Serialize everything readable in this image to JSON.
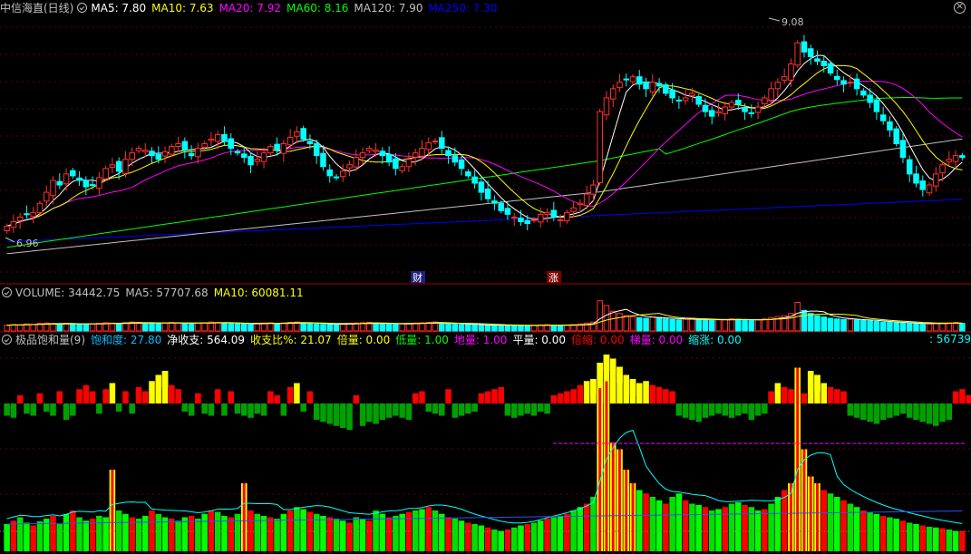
{
  "header_price": {
    "title": "中信海直(日线)",
    "items": [
      {
        "label": "MA5: 7.80",
        "color": "#ffffff"
      },
      {
        "label": "MA10: 7.63",
        "color": "#ffff00"
      },
      {
        "label": "MA20: 7.92",
        "color": "#ff00ff"
      },
      {
        "label": "MA60: 8.16",
        "color": "#00ff00"
      },
      {
        "label": "MA120: 7.90",
        "color": "#c0c0c0"
      },
      {
        "label": "MA250: 7.30",
        "color": "#0000ff"
      }
    ]
  },
  "header_volume": {
    "items": [
      {
        "label": "VOLUME: 34442.75",
        "color": "#c0c0c0"
      },
      {
        "label": "MA5: 57707.68",
        "color": "#c0c0c0"
      },
      {
        "label": "MA10: 60081.11",
        "color": "#ffff00"
      }
    ]
  },
  "header_indicator": {
    "title": "极品饱和量(9)",
    "items": [
      {
        "label": "饱和度: 27.80",
        "color": "#00c0ff"
      },
      {
        "label": "净收支: 564.09",
        "color": "#ffffff"
      },
      {
        "label": "收支比%: 21.07",
        "color": "#ffff00"
      },
      {
        "label": "倍量: 0.00",
        "color": "#ffff00"
      },
      {
        "label": "低量: 1.00",
        "color": "#00ff00"
      },
      {
        "label": "地量: 1.00",
        "color": "#ff00ff"
      },
      {
        "label": "平量: 0.00",
        "color": "#ffffff"
      },
      {
        "label": "倍缩: 0.00",
        "color": "#ff0000"
      },
      {
        "label": "梯量: 0.00",
        "color": "#ff00ff"
      },
      {
        "label": "缩涨: 0.00",
        "color": "#00ffff"
      }
    ],
    "right_value": ": 56739"
  },
  "chart_data": [
    {
      "type": "candlestick",
      "annotations": {
        "max_label": "9.08",
        "min_label": "6.96",
        "event_labels": [
          "财",
          "涨"
        ]
      },
      "ylim": [
        6.6,
        9.3
      ],
      "series_colors": {
        "up": "#ff3030",
        "down": "#00ffff",
        "ma5": "#ffffff",
        "ma10": "#ffff00",
        "ma20": "#ff00ff",
        "ma60": "#00ff00",
        "ma120": "#c0c0c0",
        "ma250": "#0000ff"
      },
      "closes": [
        7.05,
        7.1,
        7.15,
        7.18,
        7.2,
        7.3,
        7.42,
        7.55,
        7.5,
        7.62,
        7.6,
        7.55,
        7.48,
        7.5,
        7.58,
        7.68,
        7.72,
        7.65,
        7.78,
        7.85,
        7.9,
        7.88,
        7.82,
        7.78,
        7.86,
        7.92,
        7.95,
        7.88,
        7.82,
        7.9,
        7.95,
        8.0,
        8.05,
        7.98,
        7.9,
        7.85,
        7.8,
        7.72,
        7.78,
        7.85,
        7.92,
        7.88,
        7.95,
        8.02,
        8.08,
        8.0,
        7.95,
        7.82,
        7.7,
        7.6,
        7.58,
        7.65,
        7.72,
        7.8,
        7.85,
        7.9,
        7.88,
        7.82,
        7.75,
        7.68,
        7.7,
        7.78,
        7.85,
        7.9,
        7.96,
        7.98,
        7.9,
        7.82,
        7.75,
        7.68,
        7.6,
        7.52,
        7.42,
        7.35,
        7.3,
        7.22,
        7.18,
        7.15,
        7.1,
        7.08,
        7.12,
        7.18,
        7.2,
        7.15,
        7.12,
        7.2,
        7.25,
        7.3,
        7.4,
        7.5,
        8.3,
        8.45,
        8.55,
        8.62,
        8.65,
        8.68,
        8.6,
        8.55,
        8.62,
        8.58,
        8.5,
        8.45,
        8.42,
        8.45,
        8.5,
        8.38,
        8.3,
        8.25,
        8.3,
        8.35,
        8.4,
        8.38,
        8.3,
        8.28,
        8.35,
        8.45,
        8.55,
        8.62,
        8.68,
        8.82,
        9.05,
        8.95,
        8.9,
        8.85,
        8.8,
        8.72,
        8.65,
        8.6,
        8.62,
        8.55,
        8.48,
        8.4,
        8.3,
        8.2,
        8.1,
        7.95,
        7.8,
        7.62,
        7.52,
        7.45,
        7.5,
        7.62,
        7.72,
        7.78,
        7.82,
        7.8
      ],
      "volumes": [
        18,
        20,
        19,
        22,
        21,
        24,
        25,
        23,
        22,
        24,
        23,
        21,
        20,
        22,
        24,
        26,
        25,
        24,
        26,
        28,
        27,
        25,
        24,
        23,
        25,
        27,
        26,
        24,
        23,
        25,
        26,
        28,
        27,
        25,
        24,
        23,
        22,
        21,
        23,
        25,
        26,
        24,
        25,
        27,
        28,
        26,
        24,
        22,
        21,
        20,
        21,
        22,
        24,
        25,
        26,
        27,
        25,
        23,
        22,
        21,
        22,
        24,
        25,
        26,
        27,
        28,
        25,
        23,
        22,
        21,
        20,
        19,
        18,
        17,
        18,
        19,
        18,
        17,
        16,
        17,
        18,
        19,
        20,
        18,
        17,
        19,
        20,
        22,
        25,
        28,
        95,
        80,
        62,
        55,
        48,
        45,
        42,
        40,
        44,
        42,
        38,
        36,
        35,
        37,
        40,
        36,
        34,
        33,
        35,
        36,
        38,
        37,
        34,
        33,
        35,
        38,
        42,
        45,
        48,
        55,
        90,
        65,
        55,
        48,
        44,
        40,
        38,
        36,
        37,
        35,
        33,
        32,
        30,
        28,
        27,
        26,
        25,
        24,
        23,
        22,
        22,
        24,
        25,
        26,
        27,
        24
      ]
    },
    {
      "type": "bar",
      "ylim": [
        -1,
        1
      ],
      "net_flow": [
        -0.3,
        -0.35,
        0.2,
        -0.25,
        -0.3,
        0.25,
        -0.2,
        -0.3,
        0.3,
        -0.4,
        -0.3,
        0.35,
        0.45,
        0.3,
        -0.25,
        0.35,
        0.5,
        -0.2,
        0.3,
        -0.25,
        0.4,
        0.3,
        0.55,
        0.7,
        0.8,
        0.45,
        0.35,
        -0.2,
        -0.3,
        0.25,
        -0.25,
        -0.3,
        0.35,
        -0.3,
        0.3,
        -0.25,
        -0.3,
        -0.35,
        -0.25,
        -0.3,
        0.3,
        0.2,
        -0.3,
        0.4,
        0.5,
        -0.2,
        0.3,
        -0.4,
        -0.45,
        -0.5,
        -0.55,
        -0.6,
        -0.65,
        0.2,
        -0.55,
        -0.45,
        -0.5,
        -0.4,
        -0.35,
        -0.3,
        -0.35,
        -0.4,
        0.25,
        0.3,
        -0.2,
        -0.25,
        -0.3,
        0.35,
        -0.35,
        -0.3,
        -0.25,
        -0.2,
        0.25,
        0.3,
        0.35,
        0.4,
        -0.3,
        -0.35,
        -0.3,
        -0.25,
        -0.3,
        -0.2,
        -0.25,
        0.2,
        0.25,
        0.3,
        0.35,
        0.45,
        0.55,
        0.6,
        1.0,
        1.2,
        1.1,
        0.9,
        0.7,
        0.6,
        0.5,
        0.55,
        0.45,
        0.4,
        0.35,
        0.3,
        -0.3,
        -0.35,
        -0.4,
        -0.45,
        -0.35,
        -0.3,
        -0.25,
        -0.3,
        -0.35,
        -0.3,
        -0.25,
        -0.4,
        -0.3,
        -0.25,
        0.3,
        0.5,
        0.4,
        0.35,
        0.3,
        0.25,
        0.8,
        0.7,
        0.5,
        0.4,
        0.35,
        0.3,
        -0.3,
        -0.35,
        -0.4,
        -0.45,
        -0.5,
        -0.4,
        -0.35,
        -0.3,
        -0.25,
        -0.35,
        -0.4,
        -0.45,
        -0.5,
        -0.55,
        -0.45,
        -0.4,
        0.3,
        0.35,
        0.2,
        0.25,
        0.3
      ],
      "saturation": [
        0.4,
        0.45,
        0.5,
        0.42,
        0.38,
        0.44,
        0.48,
        0.52,
        0.4,
        0.55,
        0.6,
        0.5,
        0.45,
        0.48,
        0.52,
        0.5,
        1.2,
        0.6,
        0.55,
        0.5,
        0.48,
        0.52,
        0.6,
        0.55,
        0.5,
        0.48,
        0.45,
        0.5,
        0.52,
        0.48,
        0.55,
        0.6,
        0.58,
        0.52,
        0.5,
        0.55,
        1.0,
        0.6,
        0.55,
        0.52,
        0.5,
        0.48,
        0.55,
        0.6,
        0.65,
        0.62,
        0.58,
        0.55,
        0.52,
        0.5,
        0.48,
        0.45,
        0.42,
        0.5,
        0.48,
        0.45,
        0.6,
        0.55,
        0.5,
        0.52,
        0.55,
        0.58,
        0.6,
        0.62,
        0.65,
        0.6,
        0.55,
        0.5,
        0.48,
        0.45,
        0.42,
        0.4,
        0.38,
        0.35,
        0.32,
        0.3,
        0.32,
        0.35,
        0.38,
        0.4,
        0.42,
        0.45,
        0.48,
        0.5,
        0.52,
        0.55,
        0.6,
        0.65,
        0.7,
        0.8,
        2.4,
        2.5,
        1.6,
        1.5,
        1.2,
        1.0,
        0.9,
        0.85,
        0.8,
        0.75,
        0.7,
        0.8,
        0.85,
        0.75,
        0.7,
        0.68,
        0.65,
        0.6,
        0.62,
        0.65,
        0.7,
        0.72,
        0.68,
        0.65,
        0.6,
        0.62,
        0.7,
        0.8,
        0.9,
        1.0,
        2.7,
        1.5,
        1.1,
        1.0,
        0.9,
        0.85,
        0.8,
        0.75,
        0.7,
        0.65,
        0.6,
        0.58,
        0.55,
        0.52,
        0.5,
        0.48,
        0.45,
        0.42,
        0.4,
        0.38,
        0.36,
        0.35,
        0.34,
        0.32,
        0.3,
        0.3
      ]
    }
  ]
}
